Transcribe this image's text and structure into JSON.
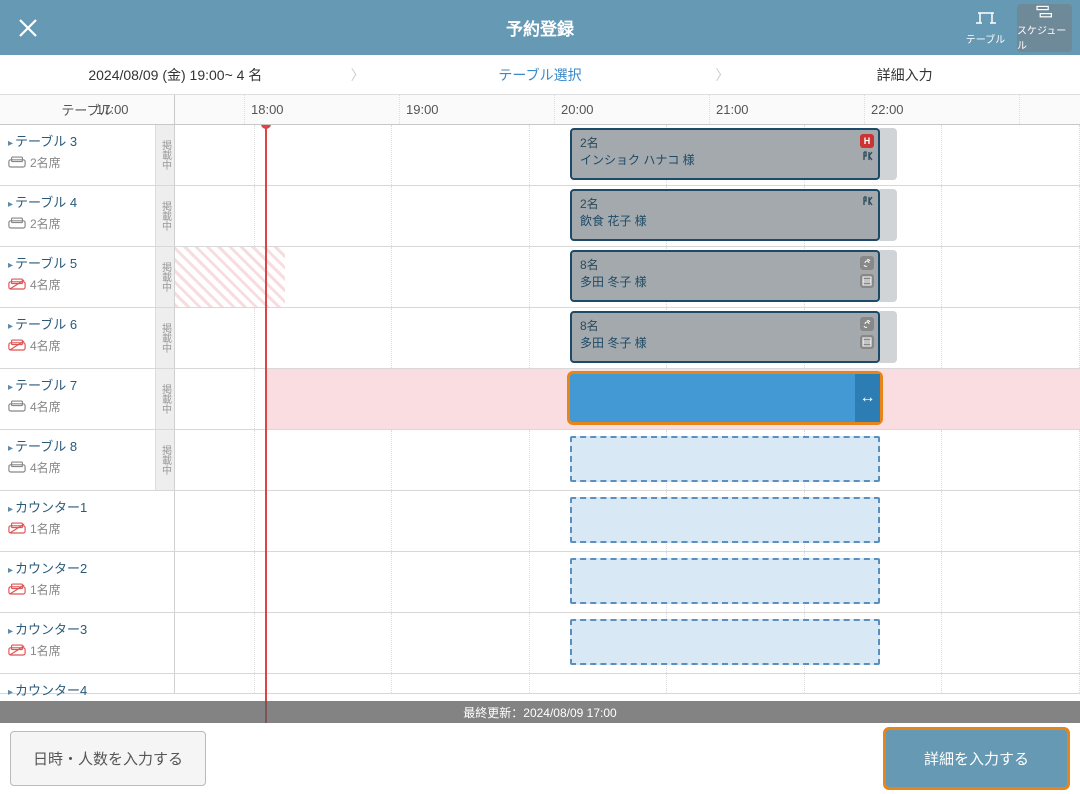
{
  "header": {
    "title": "予約登録",
    "toggle": {
      "table": "テーブル",
      "schedule": "スケジュール"
    }
  },
  "steps": {
    "s1": "2024/08/09 (金) 19:00~ 4 名",
    "s2": "テーブル選択",
    "s3": "詳細入力"
  },
  "timeHeader": {
    "label": "テーブル",
    "hours": [
      "17:00",
      "18:00",
      "19:00",
      "20:00",
      "21:00",
      "22:00"
    ]
  },
  "rows": [
    {
      "name": "テーブル 3",
      "seats": "2名席",
      "smoking": false,
      "badge": "掲載中",
      "resv": {
        "guests": "2名",
        "name": "インショク ハナコ 様",
        "icon": "h"
      }
    },
    {
      "name": "テーブル 4",
      "seats": "2名席",
      "smoking": false,
      "badge": "掲載中",
      "resv": {
        "guests": "2名",
        "name": "飲食 花子 様",
        "icon": "fork"
      }
    },
    {
      "name": "テーブル 5",
      "seats": "4名席",
      "smoking": true,
      "badge": "掲載中",
      "resv": {
        "guests": "8名",
        "name": "多田 冬子 様",
        "icon": "link"
      },
      "busy": true
    },
    {
      "name": "テーブル 6",
      "seats": "4名席",
      "smoking": true,
      "badge": "掲載中",
      "resv": {
        "guests": "8名",
        "name": "多田 冬子 様",
        "icon": "link"
      }
    },
    {
      "name": "テーブル 7",
      "seats": "4名席",
      "smoking": false,
      "badge": "掲載中",
      "selected": true,
      "pink": true
    },
    {
      "name": "テーブル 8",
      "seats": "4名席",
      "smoking": false,
      "badge": "掲載中",
      "avail": true
    },
    {
      "name": "カウンター1",
      "seats": "1名席",
      "smoking": true,
      "avail": true
    },
    {
      "name": "カウンター2",
      "seats": "1名席",
      "smoking": true,
      "avail": true
    },
    {
      "name": "カウンター3",
      "seats": "1名席",
      "smoking": true,
      "avail": true
    },
    {
      "name": "カウンター4",
      "seats": "",
      "smoking": true,
      "avail": true,
      "partial": true
    }
  ],
  "status": "最終更新：2024/08/09 17:00",
  "footer": {
    "back": "日時・人数を入力する",
    "next": "詳細を入力する"
  }
}
